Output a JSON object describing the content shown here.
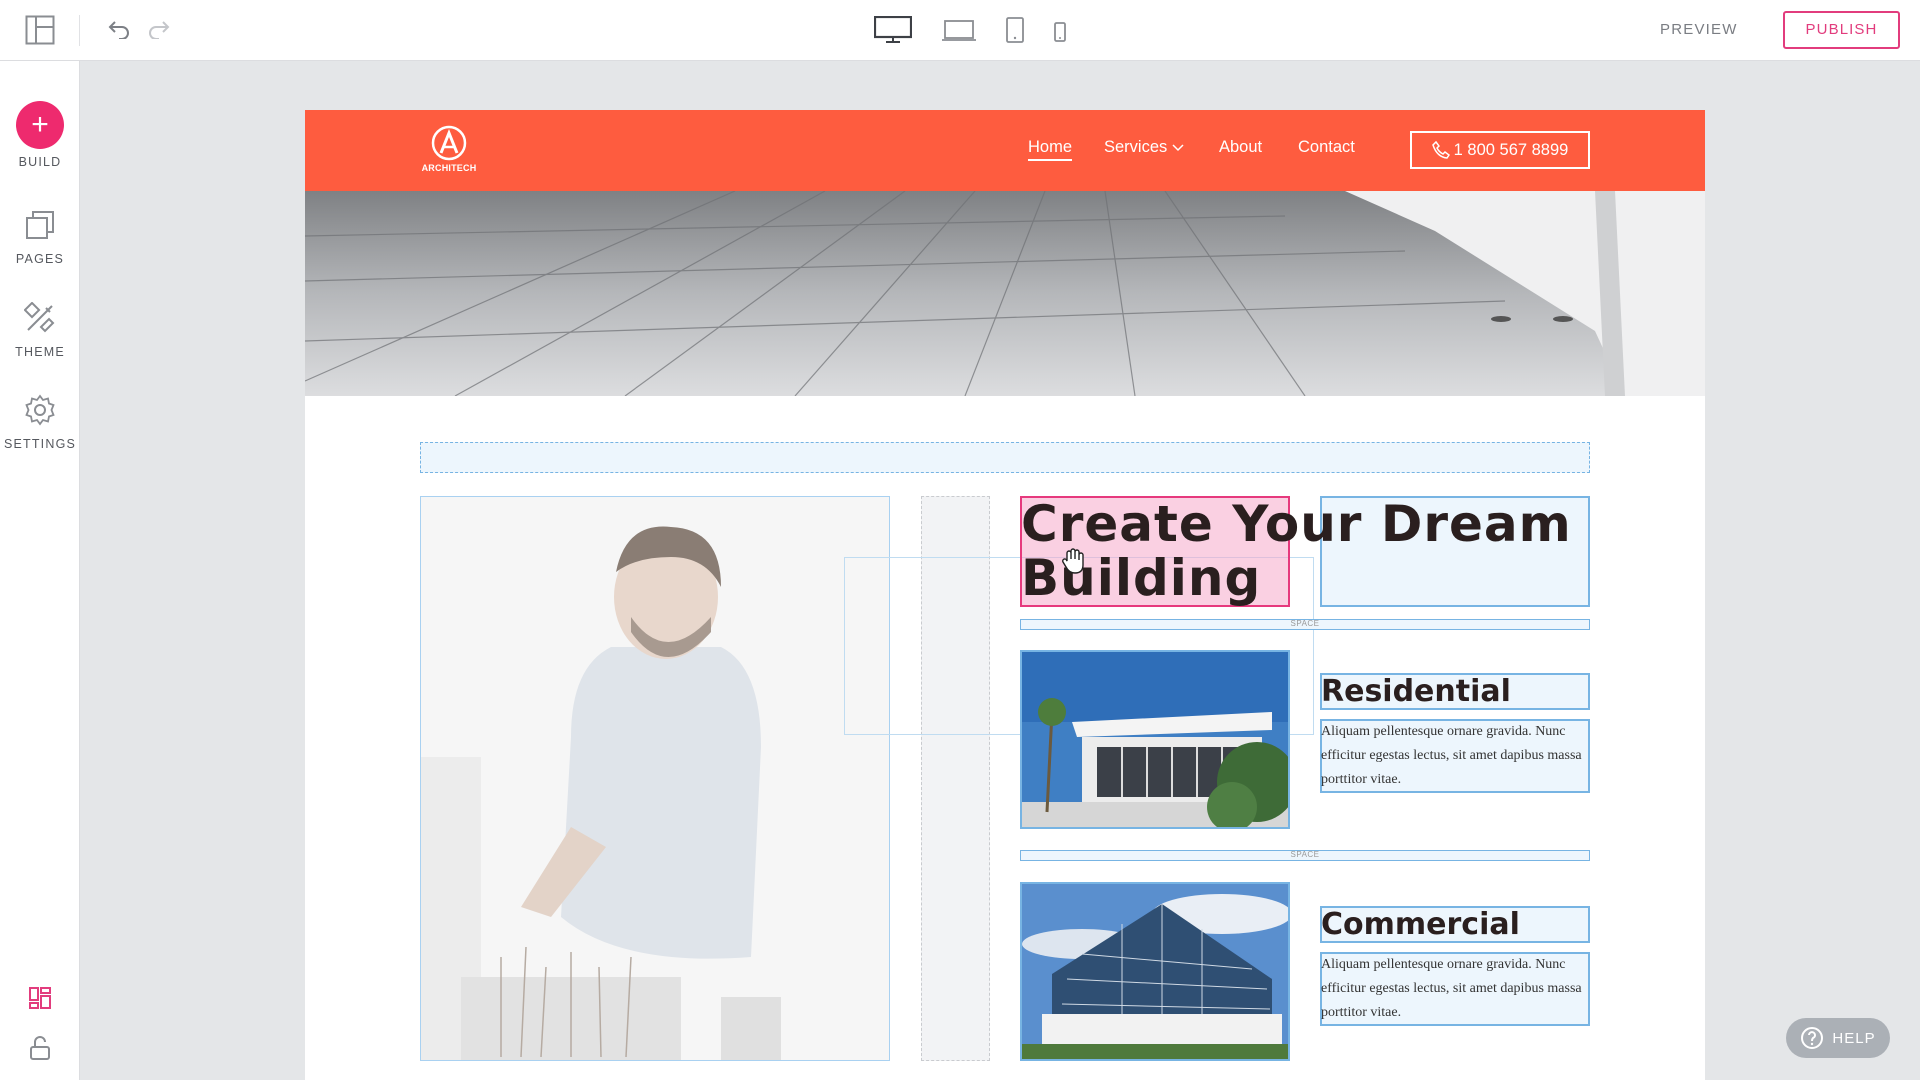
{
  "toolbar": {
    "layout_icon": "layout-icon",
    "undo_icon": "undo-icon",
    "redo_icon": "redo-icon",
    "devices": [
      "desktop",
      "laptop",
      "tablet",
      "mobile"
    ],
    "preview_label": "PREVIEW",
    "publish_label": "PUBLISH"
  },
  "sidebar": {
    "items": [
      {
        "label": "BUILD",
        "icon": "plus-icon"
      },
      {
        "label": "PAGES",
        "icon": "pages-icon"
      },
      {
        "label": "THEME",
        "icon": "theme-icon"
      },
      {
        "label": "SETTINGS",
        "icon": "gear-icon"
      }
    ],
    "bottom_icons": [
      "widgets-icon",
      "unlock-icon"
    ]
  },
  "site": {
    "logo_text": "ARCHITECH",
    "nav": {
      "home": "Home",
      "services": "Services",
      "about": "About",
      "contact": "Contact"
    },
    "phone": "1 800 567 8899",
    "heading": "Create Your Dream Building",
    "space_label": "SPACE",
    "cards": [
      {
        "title": "Residential",
        "text": "Aliquam pellentesque ornare gravida. Nunc efficitur egestas lectus, sit amet dapibus massa porttitor vitae."
      },
      {
        "title": "Commercial",
        "text": "Aliquam pellentesque ornare gravida. Nunc efficitur egestas lectus, sit amet dapibus massa porttitor vitae."
      }
    ]
  },
  "help_label": "HELP",
  "colors": {
    "brand": "#fe5c3f",
    "accent": "#e23c7d",
    "selection": "#77b4e3"
  }
}
